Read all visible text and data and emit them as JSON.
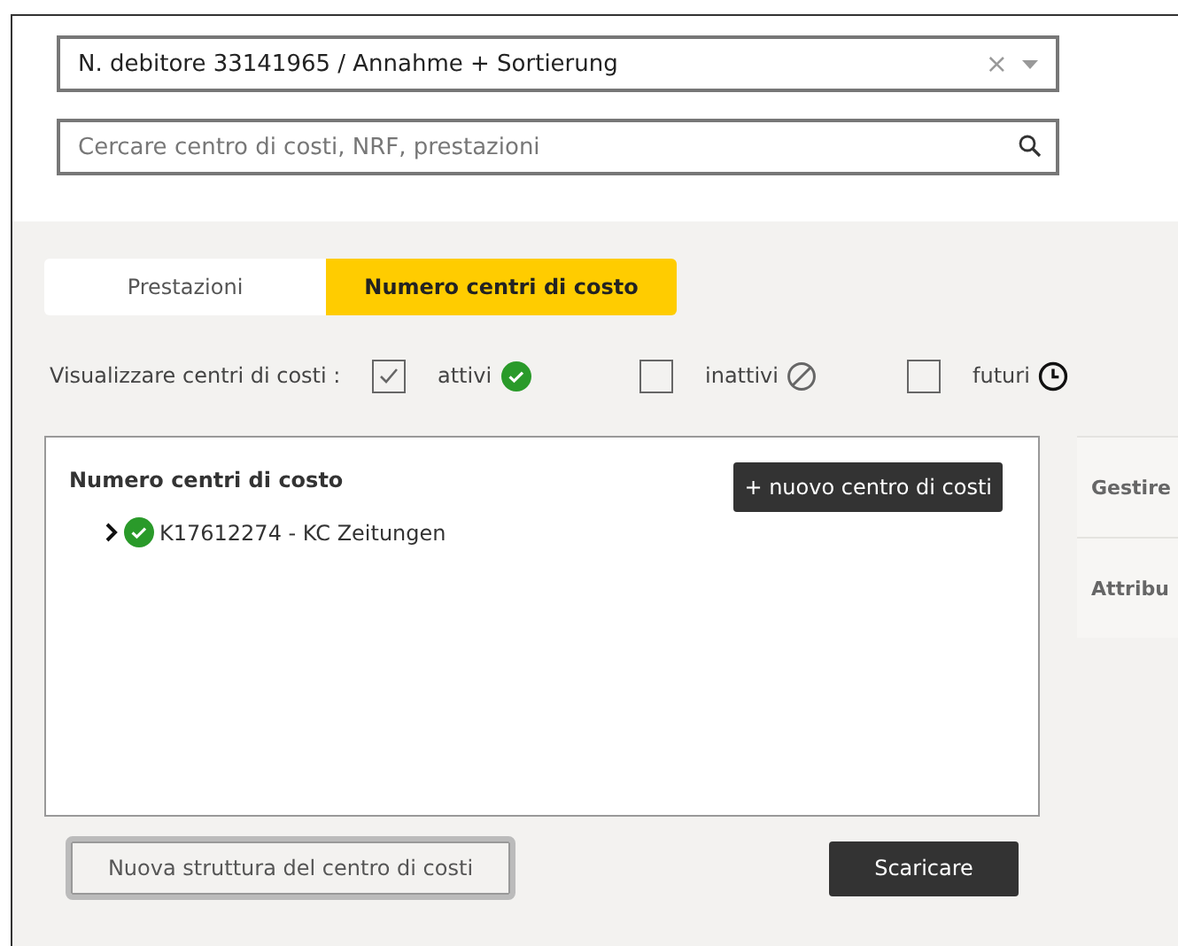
{
  "debtor_select": {
    "value": "N. debitore 33141965 / Annahme + Sortierung",
    "clear": "×"
  },
  "search": {
    "placeholder": "Cercare centro di costi, NRF, prestazioni"
  },
  "tabs": [
    {
      "label": "Prestazioni",
      "selected": false
    },
    {
      "label": "Numero centri di costo",
      "selected": true
    }
  ],
  "filter": {
    "label": "Visualizzare centri di costi :",
    "options": [
      {
        "label": "attivi",
        "checked": true,
        "kind": "active"
      },
      {
        "label": "inattivi",
        "checked": false,
        "kind": "inactive"
      },
      {
        "label": "futuri",
        "checked": false,
        "kind": "future"
      }
    ]
  },
  "tree": {
    "title": "Numero centri di costo",
    "add_button": "+ nuovo centro di costi",
    "items": [
      {
        "label": "K17612274 - KC Zeitungen",
        "expanded": false,
        "kind": "active"
      }
    ]
  },
  "side_panel": {
    "items": [
      "Gestire",
      "Attribu"
    ]
  },
  "buttons": {
    "new_structure": "Nuova struttura del centro di costi",
    "download": "Scaricare"
  }
}
